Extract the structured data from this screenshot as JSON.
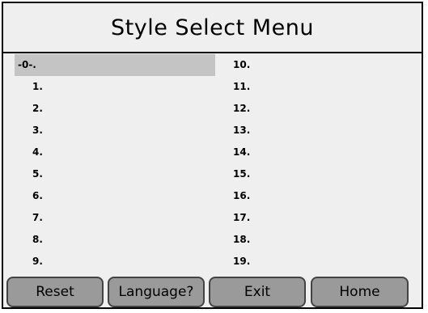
{
  "window": {
    "title": "Style Select Menu"
  },
  "styles": {
    "left": [
      "-0-.",
      "1.",
      "2.",
      "3.",
      "4.",
      "5.",
      "6.",
      "7.",
      "8.",
      "9."
    ],
    "right": [
      "10.",
      "11.",
      "12.",
      "13.",
      "14.",
      "15.",
      "16.",
      "17.",
      "18.",
      "19."
    ],
    "selected": "-0-."
  },
  "buttons": {
    "reset": "Reset",
    "language": "Language?",
    "exit": "Exit",
    "home": "Home"
  },
  "colors": {
    "background": "#efefef",
    "selected_row": "#c4c4c4",
    "button_fill": "#9a9a9a",
    "border": "#000000"
  }
}
